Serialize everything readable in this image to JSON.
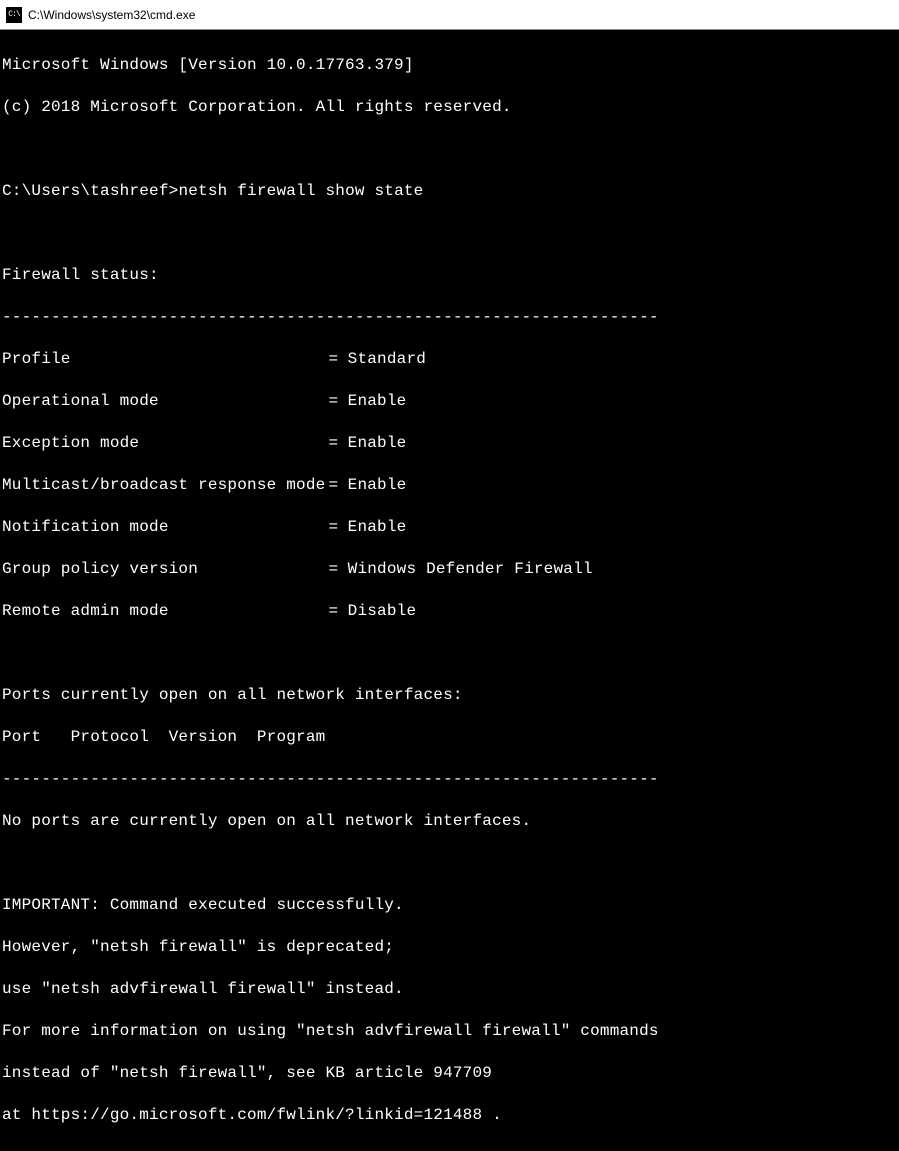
{
  "window": {
    "title": "C:\\Windows\\system32\\cmd.exe",
    "icon_label": "C:\\"
  },
  "header": {
    "line1": "Microsoft Windows [Version 10.0.17763.379]",
    "line2": "(c) 2018 Microsoft Corporation. All rights reserved."
  },
  "prompt": {
    "path": "C:\\Users\\tashreef>",
    "command": "netsh firewall show state"
  },
  "status": {
    "header": "Firewall status:",
    "divider": "-------------------------------------------------------------------",
    "rows": [
      {
        "key": "Profile",
        "value": "Standard"
      },
      {
        "key": "Operational mode",
        "value": "Enable"
      },
      {
        "key": "Exception mode",
        "value": "Enable"
      },
      {
        "key": "Multicast/broadcast response mode",
        "value": "Enable"
      },
      {
        "key": "Notification mode",
        "value": "Enable"
      },
      {
        "key": "Group policy version",
        "value": "Windows Defender Firewall"
      },
      {
        "key": "Remote admin mode",
        "value": "Disable"
      }
    ]
  },
  "ports": {
    "header": "Ports currently open on all network interfaces:",
    "columns": "Port   Protocol  Version  Program",
    "divider": "-------------------------------------------------------------------",
    "none": "No ports are currently open on all network interfaces."
  },
  "important": {
    "l1": "IMPORTANT: Command executed successfully.",
    "l2": "However, \"netsh firewall\" is deprecated;",
    "l3": "use \"netsh advfirewall firewall\" instead.",
    "l4": "For more information on using \"netsh advfirewall firewall\" commands",
    "l5": "instead of \"netsh firewall\", see KB article 947709",
    "l6": "at https://go.microsoft.com/fwlink/?linkid=121488 ."
  }
}
